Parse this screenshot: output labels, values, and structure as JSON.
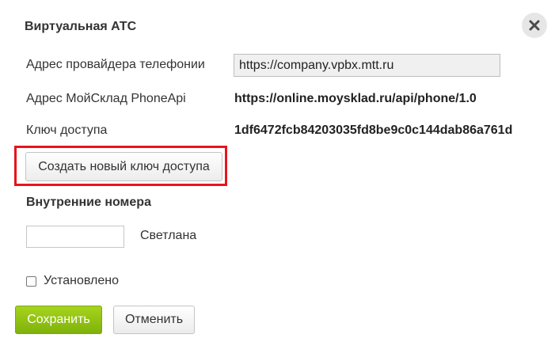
{
  "dialog": {
    "title": "Виртуальная АТС",
    "close_icon": "close-icon"
  },
  "fields": {
    "provider_label": "Адрес провайдера телефонии",
    "provider_value": "https://company.vpbx.mtt.ru",
    "phoneapi_label": "Адрес МойСклад PhoneApi",
    "phoneapi_value": "https://online.moysklad.ru/api/phone/1.0",
    "key_label": "Ключ доступа",
    "key_value": "1df6472fcb84203035fd8be9c0c144dab86a761d"
  },
  "new_key_button": {
    "label": "Создать новый ключ доступа",
    "highlight_color": "#e8141c"
  },
  "extensions": {
    "title": "Внутренние номера",
    "items": [
      {
        "number": "",
        "name": "Светлана"
      }
    ]
  },
  "installed": {
    "label": "Установлено",
    "checked": false
  },
  "actions": {
    "save_label": "Сохранить",
    "cancel_label": "Отменить",
    "save_color": "#8cc312"
  }
}
